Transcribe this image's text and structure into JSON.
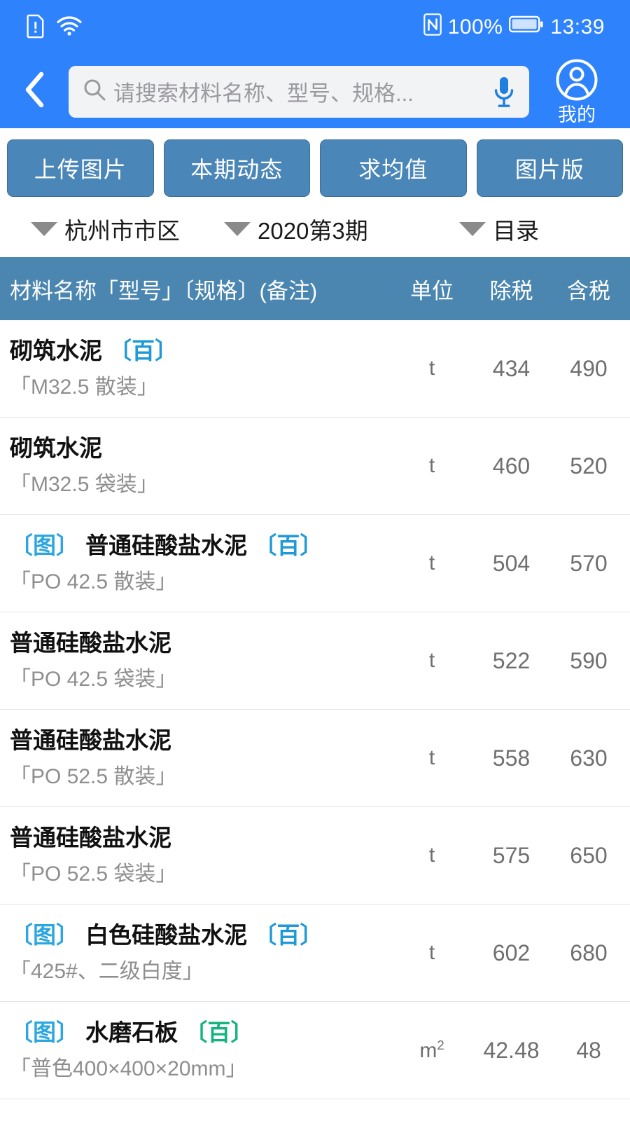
{
  "statusbar": {
    "icons_left": [
      "sim-card-alert-icon",
      "wifi-icon"
    ],
    "nfc_icon": "nfc-icon",
    "battery_percent": "100%",
    "battery_icon": "battery-full-icon",
    "time": "13:39"
  },
  "header": {
    "back_icon": "chevron-left-icon",
    "search": {
      "icon": "search-icon",
      "placeholder": "请搜索材料名称、型号、规格...",
      "value": "",
      "mic_icon": "microphone-icon"
    },
    "profile": {
      "icon": "user-circle-icon",
      "label": "我的"
    }
  },
  "actions": [
    {
      "label": "上传图片",
      "name": "upload-image-button"
    },
    {
      "label": "本期动态",
      "name": "current-period-news-button"
    },
    {
      "label": "求均值",
      "name": "average-button"
    },
    {
      "label": "图片版",
      "name": "image-version-button"
    }
  ],
  "filters": [
    {
      "label": "杭州市市区",
      "name": "filter-region"
    },
    {
      "label": "2020第3期",
      "name": "filter-period"
    },
    {
      "label": "目录",
      "name": "filter-catalog"
    }
  ],
  "table": {
    "columns": {
      "name": "材料名称「型号」〔规格〕(备注)",
      "unit": "单位",
      "ex_tax": "除税",
      "in_tax": "含税"
    },
    "rows": [
      {
        "img_tag": "",
        "title": "砌筑水泥",
        "bai_tag": "〔百〕",
        "bai_color": "blue",
        "spec": "「M32.5 散装」",
        "unit": "t",
        "ex_tax": "434",
        "in_tax": "490"
      },
      {
        "img_tag": "",
        "title": "砌筑水泥",
        "bai_tag": "",
        "bai_color": "",
        "spec": "「M32.5 袋装」",
        "unit": "t",
        "ex_tax": "460",
        "in_tax": "520"
      },
      {
        "img_tag": "〔图〕",
        "title": "普通硅酸盐水泥",
        "bai_tag": "〔百〕",
        "bai_color": "blue",
        "spec": "「PO 42.5 散装」",
        "unit": "t",
        "ex_tax": "504",
        "in_tax": "570"
      },
      {
        "img_tag": "",
        "title": "普通硅酸盐水泥",
        "bai_tag": "",
        "bai_color": "",
        "spec": "「PO 42.5 袋装」",
        "unit": "t",
        "ex_tax": "522",
        "in_tax": "590"
      },
      {
        "img_tag": "",
        "title": "普通硅酸盐水泥",
        "bai_tag": "",
        "bai_color": "",
        "spec": "「PO 52.5 散装」",
        "unit": "t",
        "ex_tax": "558",
        "in_tax": "630"
      },
      {
        "img_tag": "",
        "title": "普通硅酸盐水泥",
        "bai_tag": "",
        "bai_color": "",
        "spec": "「PO 52.5 袋装」",
        "unit": "t",
        "ex_tax": "575",
        "in_tax": "650"
      },
      {
        "img_tag": "〔图〕",
        "title": "白色硅酸盐水泥",
        "bai_tag": "〔百〕",
        "bai_color": "blue",
        "spec": "「425#、二级白度」",
        "unit": "t",
        "ex_tax": "602",
        "in_tax": "680"
      },
      {
        "img_tag": "〔图〕",
        "title": "水磨石板",
        "bai_tag": "〔百〕",
        "bai_color": "green",
        "spec": "「普色400×400×20mm」",
        "unit": "m2",
        "ex_tax": "42.48",
        "in_tax": "48"
      }
    ]
  },
  "colors": {
    "header_blue": "#2e82fb",
    "button_blue": "#4a86b8",
    "table_header_blue": "#4a86b0",
    "tag_blue": "#1f9ad6",
    "tag_green": "#15b37e"
  }
}
